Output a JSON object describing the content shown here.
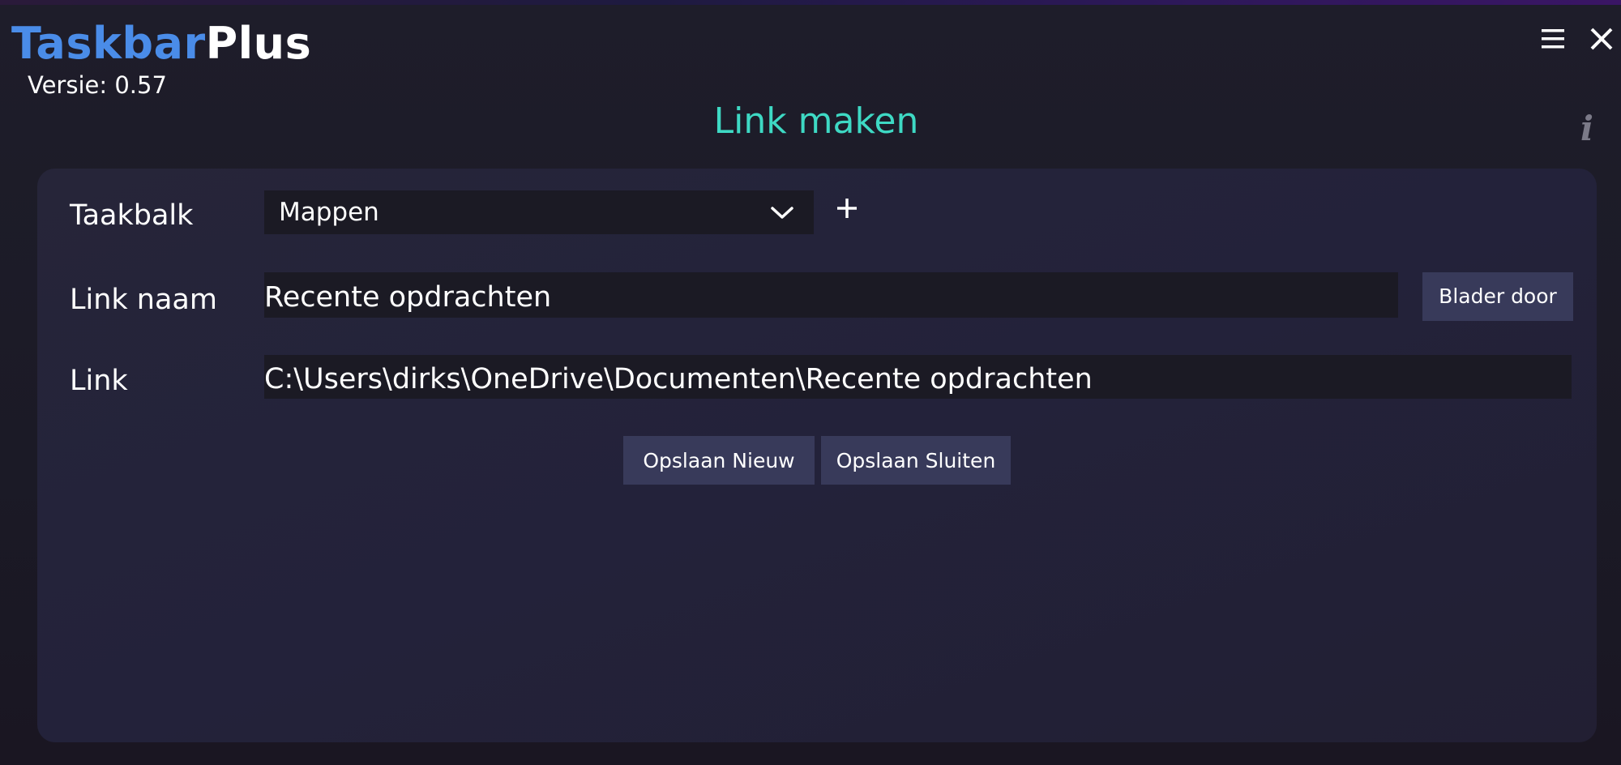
{
  "app": {
    "name_part1": "Taskbar",
    "name_part2": "Plus",
    "version": "Versie: 0.57"
  },
  "window_controls": {
    "menu_icon": "hamburger-menu-icon",
    "close_icon": "close-icon"
  },
  "page": {
    "title": "Link maken",
    "info_icon": "i"
  },
  "form": {
    "taskbar_label": "Taakbalk",
    "taskbar_selected": "Mappen",
    "link_name_label": "Link naam",
    "link_name_value": "Recente opdrachten",
    "link_label": "Link",
    "link_value": "C:\\Users\\dirks\\OneDrive\\Documenten\\Recente opdrachten"
  },
  "buttons": {
    "browse": "Blader door",
    "save_new": "Opslaan Nieuw",
    "save_close": "Opslaan Sluiten"
  },
  "colors": {
    "brand_blue": "#4a8ce8",
    "title_teal": "#3ed9c4",
    "button_bg": "#383a5a",
    "field_bg": "#1b1a24",
    "panel_bg": "#24233a"
  }
}
